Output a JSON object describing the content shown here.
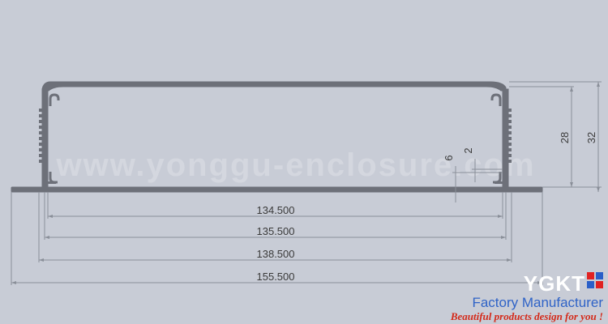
{
  "drawing": {
    "watermark": "www.yonggu-enclosure.com",
    "dimensions": {
      "widths": [
        "134.500",
        "135.500",
        "138.500",
        "155.500"
      ],
      "heights": [
        "28",
        "32"
      ],
      "details": [
        "6",
        "2"
      ]
    },
    "colors": {
      "background": "#c8ccd6",
      "profile": "#6d7079",
      "dimension_line": "#8a8f99"
    }
  },
  "logo": {
    "brand": "YGKT",
    "tagline": "Factory Manufacturer",
    "slogan": "Beautiful products design for you !",
    "colors": {
      "brand": "#ffffff",
      "tagline": "#2f63c7",
      "slogan": "#d42a1a",
      "mark_red": "#e02222",
      "mark_blue": "#2a5fc8"
    }
  }
}
